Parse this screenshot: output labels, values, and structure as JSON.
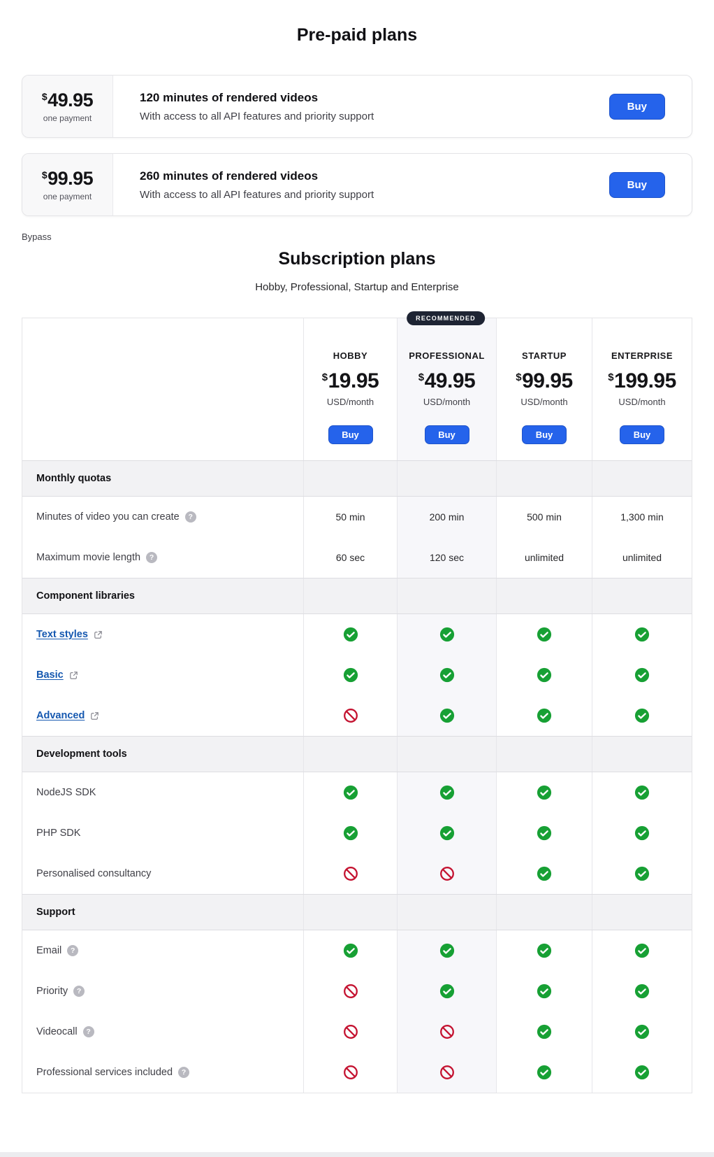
{
  "prepaid": {
    "title": "Pre-paid plans",
    "cards": [
      {
        "currency": "$",
        "price": "49.95",
        "term": "one payment",
        "title": "120 minutes of rendered videos",
        "description": "With access to all API features and priority support",
        "buy_label": "Buy"
      },
      {
        "currency": "$",
        "price": "99.95",
        "term": "one payment",
        "title": "260 minutes of rendered videos",
        "description": "With access to all API features and priority support",
        "buy_label": "Buy"
      }
    ],
    "bypass_label": "Bypass"
  },
  "subscription": {
    "title": "Subscription plans",
    "subtitle": "Hobby, Professional, Startup and Enterprise",
    "recommended_badge": "RECOMMENDED",
    "plans": [
      {
        "name": "HOBBY",
        "currency": "$",
        "price": "19.95",
        "per": "USD/month",
        "buy_label": "Buy",
        "recommended": false
      },
      {
        "name": "PROFESSIONAL",
        "currency": "$",
        "price": "49.95",
        "per": "USD/month",
        "buy_label": "Buy",
        "recommended": true
      },
      {
        "name": "STARTUP",
        "currency": "$",
        "price": "99.95",
        "per": "USD/month",
        "buy_label": "Buy",
        "recommended": false
      },
      {
        "name": "ENTERPRISE",
        "currency": "$",
        "price": "199.95",
        "per": "USD/month",
        "buy_label": "Buy",
        "recommended": false
      }
    ],
    "sections": [
      {
        "label": "Monthly quotas",
        "rows": [
          {
            "label": "Minutes of video you can create",
            "help": true,
            "values": [
              "50 min",
              "200 min",
              "500 min",
              "1,300 min"
            ]
          },
          {
            "label": "Maximum movie length",
            "help": true,
            "values": [
              "60 sec",
              "120 sec",
              "unlimited",
              "unlimited"
            ]
          }
        ]
      },
      {
        "label": "Component libraries",
        "rows": [
          {
            "label": "Text styles",
            "link": true,
            "values": [
              "yes",
              "yes",
              "yes",
              "yes"
            ]
          },
          {
            "label": "Basic",
            "link": true,
            "values": [
              "yes",
              "yes",
              "yes",
              "yes"
            ]
          },
          {
            "label": "Advanced",
            "link": true,
            "values": [
              "no",
              "yes",
              "yes",
              "yes"
            ]
          }
        ]
      },
      {
        "label": "Development tools",
        "rows": [
          {
            "label": "NodeJS SDK",
            "values": [
              "yes",
              "yes",
              "yes",
              "yes"
            ]
          },
          {
            "label": "PHP SDK",
            "values": [
              "yes",
              "yes",
              "yes",
              "yes"
            ]
          },
          {
            "label": "Personalised consultancy",
            "values": [
              "no",
              "no",
              "yes",
              "yes"
            ]
          }
        ]
      },
      {
        "label": "Support",
        "rows": [
          {
            "label": "Email",
            "help": true,
            "values": [
              "yes",
              "yes",
              "yes",
              "yes"
            ]
          },
          {
            "label": "Priority",
            "help": true,
            "values": [
              "no",
              "yes",
              "yes",
              "yes"
            ]
          },
          {
            "label": "Videocall",
            "help": true,
            "values": [
              "no",
              "no",
              "yes",
              "yes"
            ]
          },
          {
            "label": "Professional services included",
            "help": true,
            "values": [
              "no",
              "no",
              "yes",
              "yes"
            ]
          }
        ]
      }
    ]
  },
  "icons": {
    "included": "check-icon",
    "excluded": "prohibited-icon",
    "help": "help-icon",
    "external": "external-link-icon"
  },
  "colors": {
    "accent_blue": "#2563eb",
    "check_green": "#17a034",
    "prohibited_red": "#c41230",
    "link_blue": "#1558b0",
    "badge_navy": "#1e2433",
    "band_gray": "#f2f2f4",
    "recommended_column_bg": "#f7f7fa"
  }
}
